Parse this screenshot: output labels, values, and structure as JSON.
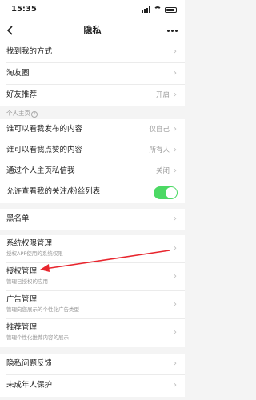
{
  "status_bar": {
    "time": "15:35"
  },
  "nav": {
    "back_icon": "back-arrow-icon",
    "title": "隐私",
    "more_icon": "more-dots-icon"
  },
  "rows_top": [
    {
      "label": "找到我的方式"
    },
    {
      "label": "淘友圈"
    },
    {
      "label": "好友推荐",
      "value": "开启"
    }
  ],
  "section_personal": {
    "label": "个人主页",
    "icon": "help-circle-icon"
  },
  "rows_personal": [
    {
      "label": "谁可以看我发布的内容",
      "value": "仅自己"
    },
    {
      "label": "谁可以看我点赞的内容",
      "value": "所有人"
    },
    {
      "label": "通过个人主页私信我",
      "value": "关闭"
    },
    {
      "label": "允许查看我的关注/粉丝列表",
      "toggle_on": true
    }
  ],
  "row_blacklist": {
    "label": "黑名单"
  },
  "rows_permissions": [
    {
      "label": "系统权限管理",
      "sub": "授权APP使用的系统权限"
    },
    {
      "label": "授权管理",
      "sub": "管理已授权的应用"
    },
    {
      "label": "广告管理",
      "sub": "管理向您展示的个性化广告类型"
    },
    {
      "label": "推荐管理",
      "sub": "管理个性化推荐内容的展示"
    }
  ],
  "rows_bottom": [
    {
      "label": "隐私问题反馈"
    },
    {
      "label": "未成年人保护"
    }
  ],
  "colors": {
    "toggle_on": "#4cd964",
    "annotation_arrow": "#e8262e"
  }
}
